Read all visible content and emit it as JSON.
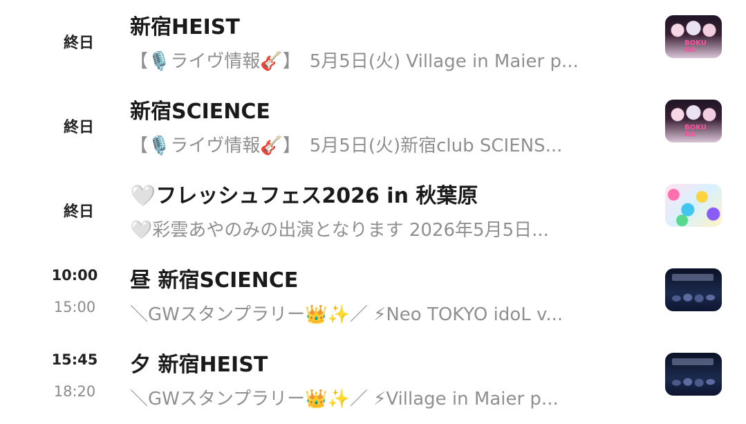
{
  "events": [
    {
      "time_label": "終日",
      "title": "新宿HEIST",
      "description": "【🎙️ライヴ情報🎸】　5月5日(火) Village in Maier p...",
      "thumbnail": "boku-ra-group-photo"
    },
    {
      "time_label": "終日",
      "title": "新宿SCIENCE",
      "description": "【🎙️ライヴ情報🎸】　5月5日(火)新宿club SCIENS...",
      "thumbnail": "boku-ra-group-photo"
    },
    {
      "time_label": "終日",
      "title": "🤍フレッシュフェス2026 in 秋葉原",
      "description": "🤍彩雲あやのみの出演となります  2026年5月5日...",
      "thumbnail": "festival-collage"
    },
    {
      "start_time": "10:00",
      "end_time": "15:00",
      "title": "昼 新宿SCIENCE",
      "description": "＼GWスタンプラリー👑✨／ ⚡Neo TOKYO idoL v...",
      "thumbnail": "dark-stage-photo"
    },
    {
      "start_time": "15:45",
      "end_time": "18:20",
      "title": "夕 新宿HEIST",
      "description": "＼GWスタンプラリー👑✨／ ⚡Village in Maier p...",
      "thumbnail": "dark-stage-photo"
    }
  ],
  "colors": {
    "title": "#1a1a1a",
    "description": "#8f8f8f",
    "time_primary": "#222222",
    "time_secondary": "#8a8a8a"
  }
}
